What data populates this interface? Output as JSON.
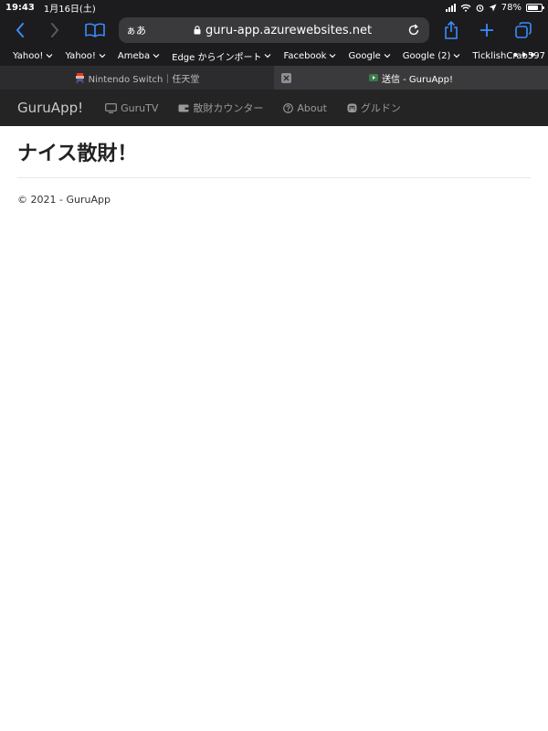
{
  "status_bar": {
    "time": "19:43",
    "date": "1月16日(土)",
    "battery": "78%",
    "battery_level": 0.78
  },
  "toolbar": {
    "reader_label": "ぁあ",
    "url": "guru-app.azurewebsites.net",
    "accent": "#3a8cff"
  },
  "bookmarks": {
    "items": [
      "Yahoo!",
      "Yahoo!",
      "Ameba",
      "Edge からインポート",
      "Facebook",
      "Google",
      "Google (2)",
      "TicklishCrab597"
    ],
    "more": "•••"
  },
  "tabs": [
    {
      "title": "Nintendo Switch｜任天堂"
    },
    {
      "title": "送信 - GuruApp!"
    }
  ],
  "site": {
    "brand": "GuruApp!",
    "nav": [
      {
        "label": "GuruTV",
        "icon": "tv-icon"
      },
      {
        "label": "散財カウンター",
        "icon": "wallet-icon"
      },
      {
        "label": "About",
        "icon": "help-circle-icon"
      },
      {
        "label": "グルドン",
        "icon": "mastodon-icon"
      }
    ]
  },
  "main": {
    "title": "ナイス散財！",
    "footer": "© 2021 - GuruApp"
  }
}
